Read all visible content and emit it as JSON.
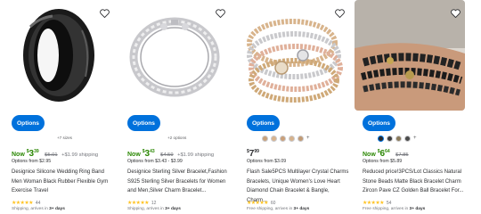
{
  "products": [
    {
      "options_label": "Options",
      "options_count": "+7 sizes",
      "price_prefix": "Now ",
      "price_dollar": "$",
      "price_main": "3",
      "price_cents": "39",
      "was_price": "$5.01",
      "shipping_fee": "+$1.99 shipping",
      "options_from": "Options from $2.95",
      "title": "Designice Silicone Wedding Ring Band Men Woman Black Rubber Flexible Gym Exercise Travel",
      "rating_count": "44",
      "shipping_text": "Shipping, arrives in",
      "shipping_days": "3+ days"
    },
    {
      "options_label": "Options",
      "options_count": "+2 options",
      "price_prefix": "Now ",
      "price_dollar": "$",
      "price_main": "3",
      "price_cents": "43",
      "was_price": "$4.59",
      "shipping_fee": "+$1.99 shipping",
      "options_from": "Options from $3.43 - $3.99",
      "title": "Designice Sterling Silver Bracelet,Fashion S925 Sterling Silver Bracelets for Women and Men,Silver Charm Bracelet...",
      "rating_count": "12",
      "shipping_text": "Shipping, arrives in",
      "shipping_days": "3+ days"
    },
    {
      "options_label": "Options",
      "swatch_colors": [
        "#c9a27a",
        "#d9b48e",
        "#caa07a",
        "#d6b28c",
        "#c19a74"
      ],
      "swatch_plus": "+",
      "price_dollar": "$",
      "price_main": "7",
      "price_cents": "99",
      "options_from": "Options from $3.09",
      "title": "Flash Sale5PCS Multilayer Crystal Charms Bracelets, Unique Women's Love Heart Diamond Chain Bracelet & Bangle, Charm...",
      "rating_count": "60",
      "shipping_text": "Free shipping, arrives in",
      "shipping_days": "3+ days"
    },
    {
      "options_label": "Options",
      "swatch_colors": [
        "#2a2a2a",
        "#3b3b3b",
        "#8a7a5a",
        "#4a4a4a"
      ],
      "swatch_plus": "+",
      "price_prefix": "Now ",
      "price_dollar": "$",
      "price_main": "6",
      "price_cents": "64",
      "was_price": "$7.85",
      "options_from": "Options from $5.89",
      "title": "Reduced price!3PCS/Lot Classics Natural Stone Beads Matte Black Bracelet Charm Zircon Pave CZ Golden Ball Bracelet For...",
      "rating_count": "54",
      "shipping_text": "Free shipping, arrives in",
      "shipping_days": "3+ days"
    }
  ]
}
